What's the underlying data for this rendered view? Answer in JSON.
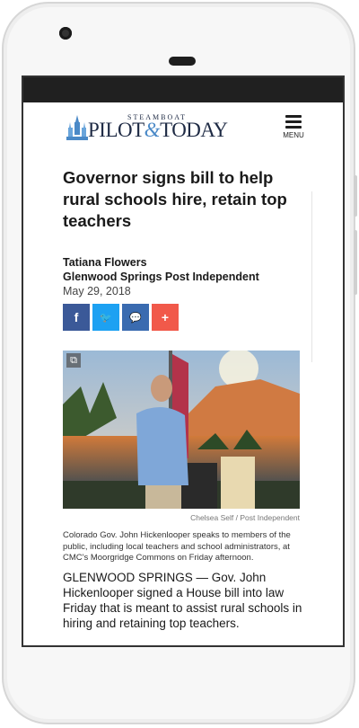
{
  "masthead": {
    "logo_top": "STEAMBOAT",
    "logo_left": "PILOT",
    "logo_amp": "&",
    "logo_right": "TODAY",
    "menu_label": "MENU"
  },
  "article": {
    "headline": "Governor signs bill to help rural schools hire, retain top teachers",
    "author": "Tatiana Flowers",
    "publication": "Glenwood Springs Post Independent",
    "date": "May 29, 2018",
    "share_buttons": [
      {
        "icon": "facebook-icon",
        "glyph": "f",
        "color": "#3b5998"
      },
      {
        "icon": "twitter-icon",
        "glyph": "🐦",
        "color": "#1da1f2"
      },
      {
        "icon": "comment-icon",
        "glyph": "💬",
        "color": "#3a6bb0"
      },
      {
        "icon": "plus-icon",
        "glyph": "+",
        "color": "#f1594a"
      }
    ],
    "photo_credit": "Chelsea Self / Post Independent",
    "caption": "Colorado Gov. John Hickenlooper speaks to members of the public, including local teachers and school administrators, at CMC's Moorgridge Commons on Friday afternoon.",
    "body": "GLENWOOD SPRINGS — Gov. John Hickenlooper signed a House bill into law Friday that is meant to assist rural schools in hiring and retaining top teachers."
  }
}
